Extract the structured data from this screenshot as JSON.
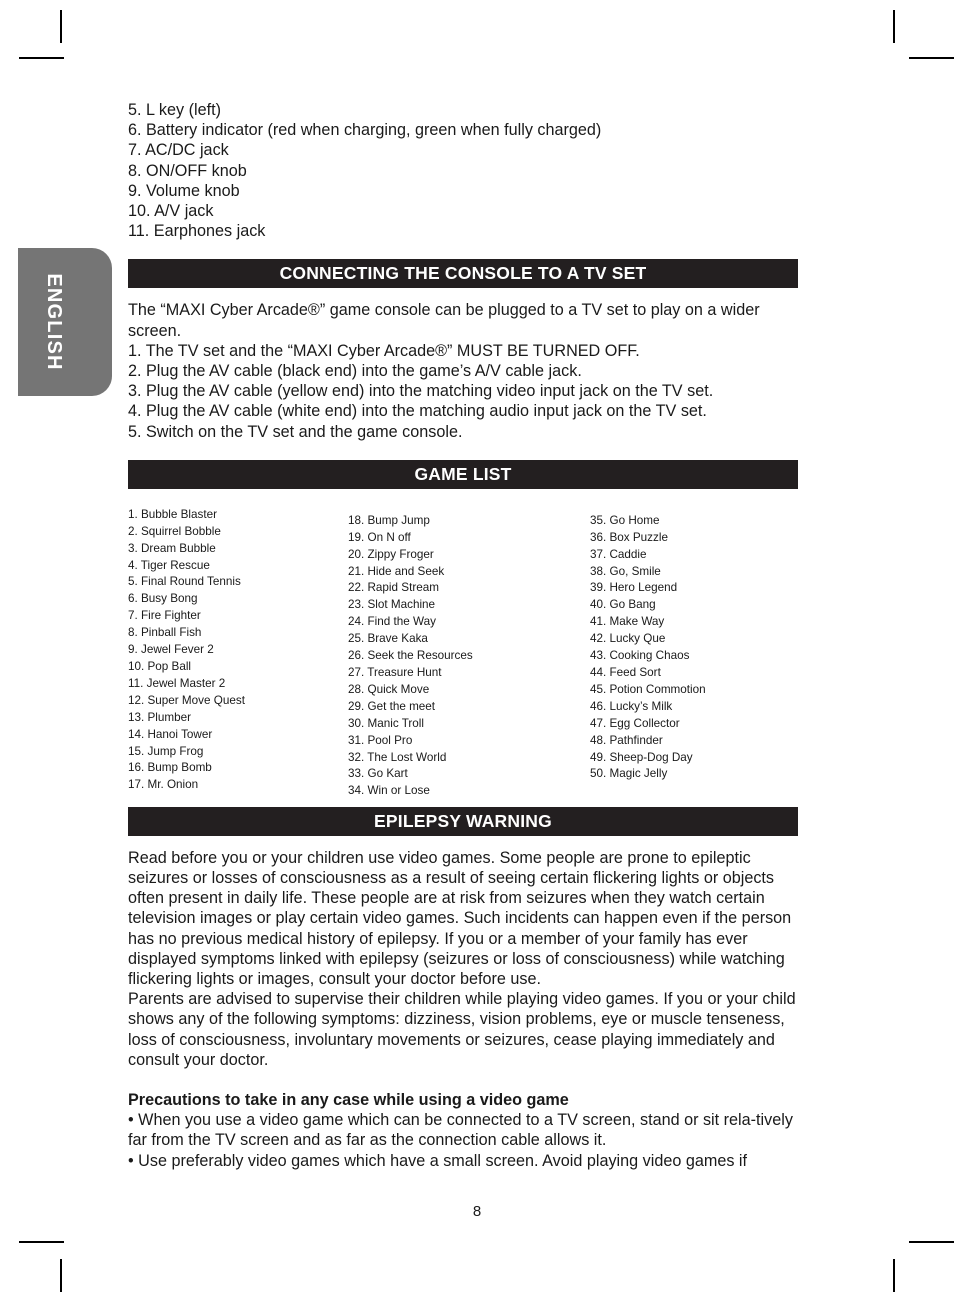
{
  "page": {
    "number": "8",
    "language_tab": "ENGLISH"
  },
  "parts_list": {
    "items": [
      "5. L key (left)",
      "6. Battery indicator (red when charging, green when fully charged)",
      "7. AC/DC jack",
      "8. ON/OFF knob",
      "9. Volume knob",
      "10. A/V jack",
      "11. Earphones jack"
    ]
  },
  "connecting_section": {
    "heading": "CONNECTING THE CONSOLE TO A TV SET",
    "intro": "The “MAXI Cyber Arcade®” game console can be plugged to a TV set to play on a wider screen.",
    "steps": [
      "1. The TV set and the “MAXI Cyber Arcade®” MUST BE TURNED OFF.",
      "2. Plug the AV cable (black end) into the game’s A/V cable jack.",
      "3. Plug the AV cable (yellow end) into the matching video input jack on the TV set.",
      "4. Plug the AV cable (white end) into the matching audio input jack on the TV set.",
      "5. Switch on the TV set and the game console."
    ]
  },
  "game_list_section": {
    "heading": "GAME LIST",
    "column1": [
      "1. Bubble Blaster",
      "2. Squirrel Bobble",
      "3. Dream Bubble",
      "4. Tiger Rescue",
      "5. Final Round Tennis",
      "6. Busy Bong",
      "7. Fire Fighter",
      "8. Pinball Fish",
      "9. Jewel Fever 2",
      "10. Pop Ball",
      "11. Jewel Master 2",
      "12. Super Move Quest",
      "13. Plumber",
      "14. Hanoi Tower",
      "15. Jump Frog",
      "16. Bump Bomb",
      "17. Mr. Onion"
    ],
    "column2": [
      "18. Bump Jump",
      "19. On N off",
      "20. Zippy Froger",
      "21. Hide and Seek",
      "22. Rapid Stream",
      "23. Slot Machine",
      "24. Find the Way",
      "25. Brave Kaka",
      "26. Seek the Resources",
      "27. Treasure Hunt",
      "28. Quick Move",
      "29. Get the meet",
      "30. Manic Troll",
      "31. Pool Pro",
      "32. The Lost World",
      "33. Go Kart",
      "34. Win or Lose"
    ],
    "column3": [
      "35. Go Home",
      "36. Box Puzzle",
      "37. Caddie",
      "38. Go, Smile",
      "39. Hero Legend",
      "40. Go Bang",
      "41. Make Way",
      "42. Lucky Que",
      "43. Cooking Chaos",
      "44. Feed Sort",
      "45. Potion Commotion",
      "46. Lucky’s Milk",
      "47. Egg Collector",
      "48. Pathfinder",
      "49. Sheep-Dog Day",
      "50. Magic Jelly"
    ]
  },
  "epilepsy_section": {
    "heading": "EPILEPSY WARNING",
    "paragraph1": "Read before you or your children use video games. Some people are prone to epileptic seizures or losses of consciousness as a result of seeing certain flickering lights or objects often present in daily life. These people are at risk from seizures when they watch certain television images or play certain video games. Such incidents can happen even if the person has no previous medical history of epilepsy. If you or a member of your family has ever displayed symptoms linked with epilepsy (seizures or loss of consciousness) while watching flickering lights or images, consult your doctor before use.",
    "paragraph2": "Parents are advised to supervise their children while playing video games. If you or your child shows any of the following symptoms: dizziness, vision problems, eye or muscle tenseness, loss of consciousness, involuntary movements or seizures, cease playing immediately and consult your doctor.",
    "precautions_heading": "Precautions to take in any case while using a video game",
    "bullet1": "• When you use a video game which can be connected to a TV screen, stand or sit rela-tively far from the TV screen and as far as the connection cable allows it.",
    "bullet2": "• Use preferably video games which have a small screen. Avoid playing video games if"
  },
  "colors": {
    "section_bar": "#231f20",
    "language_tab": "#757575",
    "text": "#1a1a1a"
  }
}
